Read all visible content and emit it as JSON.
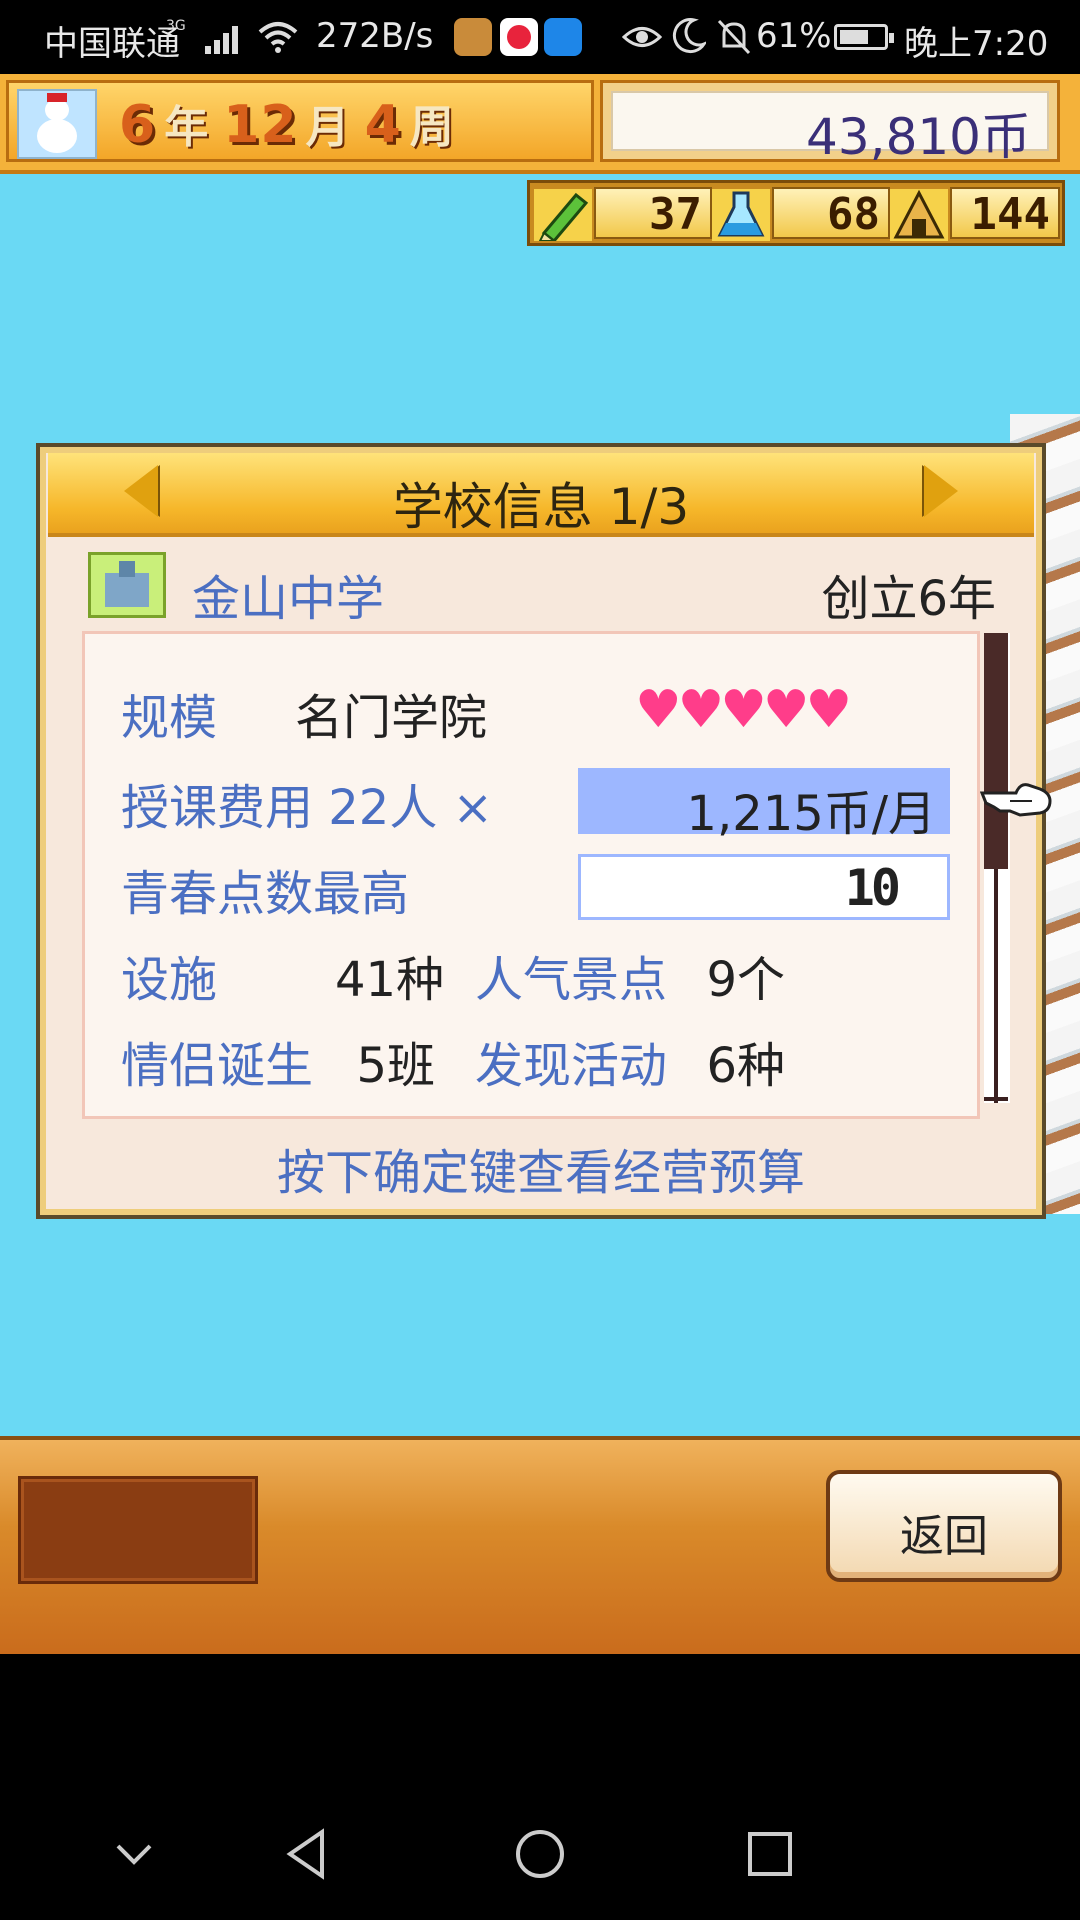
{
  "status_bar": {
    "carrier": "中国联通",
    "network": "3G",
    "speed": "272B/s",
    "battery": "61%",
    "time": "晚上7:20"
  },
  "hud": {
    "year": "6",
    "year_unit": "年",
    "month": "12",
    "month_unit": "月",
    "week": "4",
    "week_unit": "周",
    "money": "43,810币",
    "stats": [
      "37",
      "68",
      "144"
    ]
  },
  "dialog": {
    "title": "学校信息 1/3",
    "school_name": "金山中学",
    "founded": "创立6年",
    "rows": {
      "scale_label": "规模",
      "scale_value": "名门学院",
      "hearts": "♥♥♥♥♥",
      "hearts_count": 5,
      "fee_label": "授课费用 22人 ×",
      "fee_value": "1,215币/月",
      "youth_label": "青春点数最高",
      "youth_value": "10",
      "facilities_label": "设施",
      "facilities_value": "41种",
      "spots_label": "人气景点",
      "spots_value": "9个",
      "couples_label": "情侣诞生",
      "couples_value": "5班",
      "activities_label": "发现活动",
      "activities_value": "6种"
    },
    "hint": "按下确定键查看经营预算"
  },
  "bottom": {
    "back_label": "返回"
  },
  "colors": {
    "sky": "#6ad9f4",
    "label_blue": "#4b6fc2",
    "highlight": "#9db7ff",
    "heart": "#ff3d8a"
  }
}
